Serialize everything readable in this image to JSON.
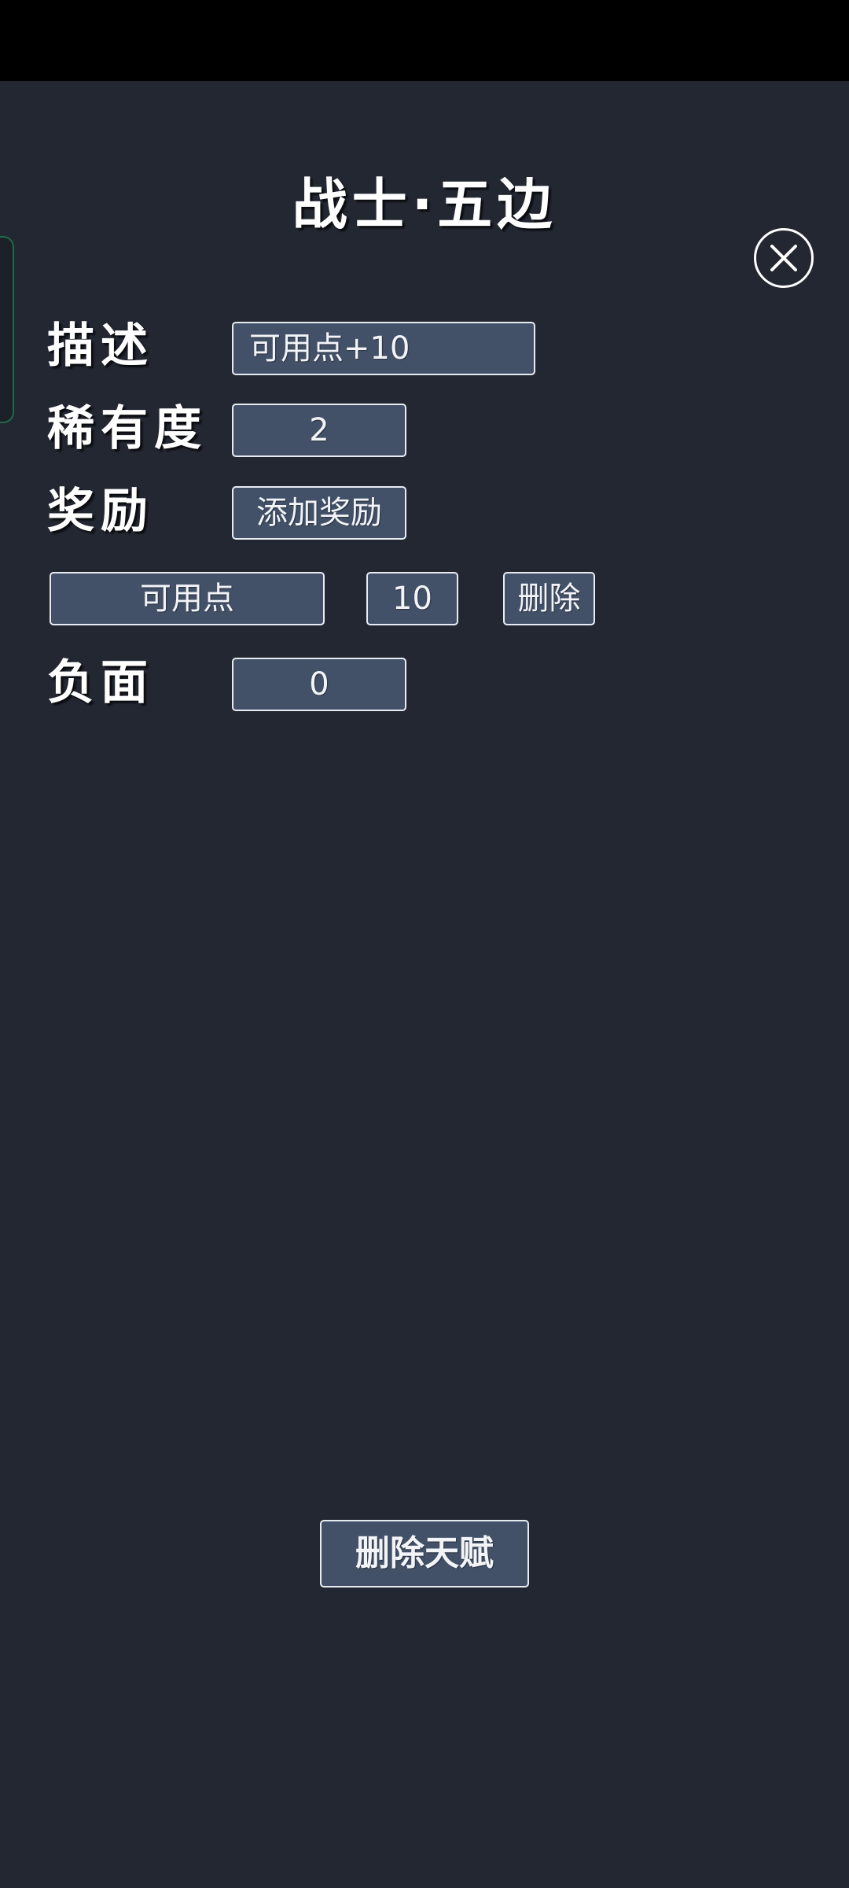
{
  "title": "战士·五边",
  "labels": {
    "description": "描述",
    "rarity": "稀有度",
    "reward": "奖励",
    "negative": "负面"
  },
  "fields": {
    "description_value": "可用点+10",
    "rarity_value": "2",
    "add_reward_label": "添加奖励",
    "reward_type_value": "可用点",
    "reward_amount_value": "10",
    "delete_reward_label": "删除",
    "negative_value": "0"
  },
  "actions": {
    "delete_talent_label": "删除天赋"
  },
  "icons": {
    "close": "close-icon"
  },
  "colors": {
    "background": "#232732",
    "field": "#435168",
    "status_bar": "#000000",
    "side_tab_border": "#1f6b46"
  }
}
